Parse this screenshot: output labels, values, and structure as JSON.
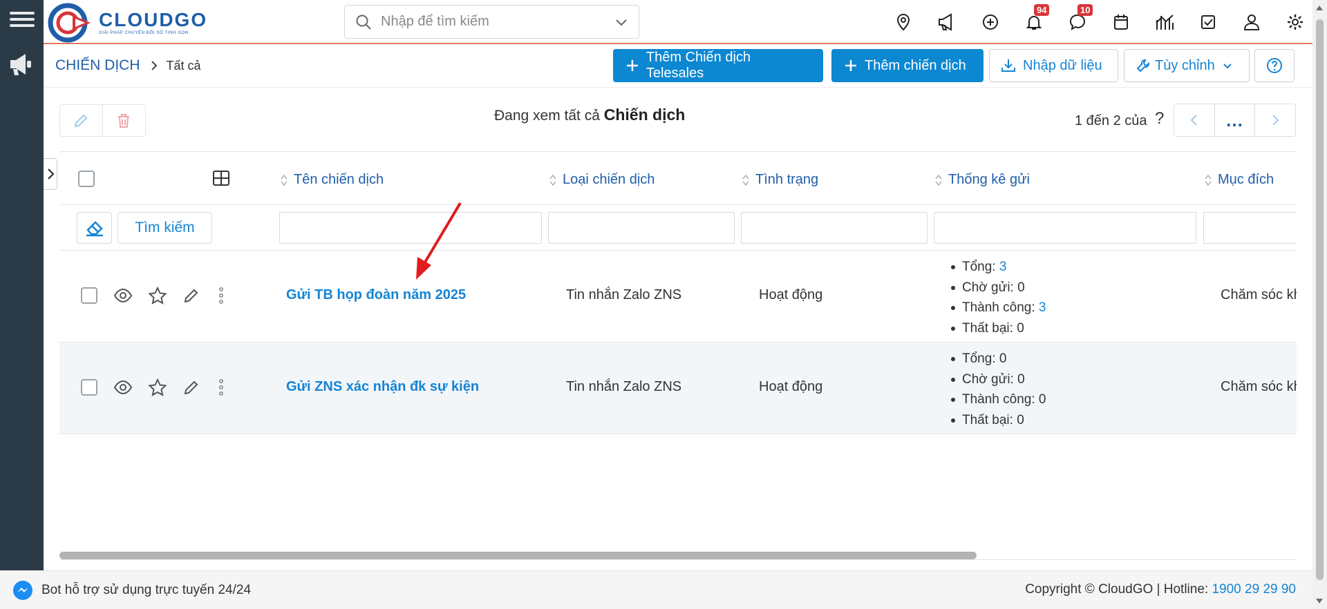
{
  "app": {
    "logo_name": "CLOUDGO",
    "logo_tagline": "GIẢI PHÁP CHUYỂN ĐỔI SỐ TINH GỌN"
  },
  "search": {
    "placeholder": "Nhập để tìm kiếm"
  },
  "topbar_icons": [
    {
      "name": "location-pin-icon"
    },
    {
      "name": "megaphone-icon"
    },
    {
      "name": "add-circle-icon"
    },
    {
      "name": "bell-icon",
      "badge": "94"
    },
    {
      "name": "chat-icon",
      "badge": "10"
    },
    {
      "name": "calendar-icon"
    },
    {
      "name": "chart-icon"
    },
    {
      "name": "task-check-icon"
    },
    {
      "name": "user-icon"
    },
    {
      "name": "settings-gear-icon"
    }
  ],
  "breadcrumb": {
    "module": "CHIẾN DỊCH",
    "view": "Tất cả"
  },
  "toolbar": {
    "add_telesales": "Thêm Chiến dịch Telesales",
    "add_campaign": "Thêm chiến dịch",
    "import": "Nhập dữ liệu",
    "customize": "Tùy chỉnh"
  },
  "listview": {
    "viewing_prefix": "Đang xem tất cả",
    "viewing_module": "Chiến dịch",
    "pager_text": "1 đến 2 của",
    "pager_q": "?",
    "pager_more": "..."
  },
  "columns": [
    "Tên chiến dịch",
    "Loại chiến dịch",
    "Tình trạng",
    "Thống kê gửi",
    "Mục đích"
  ],
  "filter": {
    "search_button": "Tìm kiếm"
  },
  "rows": [
    {
      "name": "Gửi TB họp đoàn năm 2025",
      "type": "Tin nhắn Zalo ZNS",
      "status": "Hoạt động",
      "stats": {
        "total_label": "Tổng:",
        "total": "3",
        "pending_label": "Chờ gửi:",
        "pending": "0",
        "success_label": "Thành công:",
        "success": "3",
        "failed_label": "Thất bại:",
        "failed": "0"
      },
      "purpose": "Chăm sóc kh"
    },
    {
      "name": "Gửi ZNS xác nhận đk sự kiện",
      "type": "Tin nhắn Zalo ZNS",
      "status": "Hoạt động",
      "stats": {
        "total_label": "Tổng:",
        "total": "0",
        "pending_label": "Chờ gửi:",
        "pending": "0",
        "success_label": "Thành công:",
        "success": "0",
        "failed_label": "Thất bại:",
        "failed": "0"
      },
      "purpose": "Chăm sóc kh"
    }
  ],
  "footer": {
    "bot_text": "Bot hỗ trợ sử dụng trực tuyến 24/24",
    "copyright": "Copyright © CloudGO | Hotline: ",
    "hotline": "1900 29 29 90"
  },
  "colors": {
    "primary": "#0c87d2",
    "link": "#1484d4",
    "heading": "#1f5ea8",
    "sidebar": "#2b3a47",
    "badge": "#d9343a",
    "topbar_accent": "#e2795d"
  }
}
